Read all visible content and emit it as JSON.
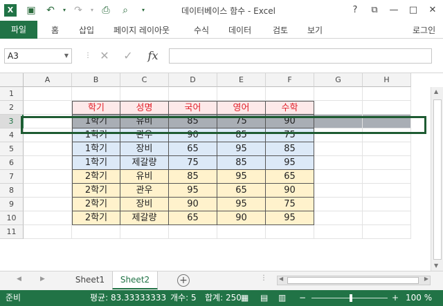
{
  "window": {
    "title": "데이터베이스 함수 - Excel",
    "help": "?",
    "restore": "⧉",
    "minimize": "—",
    "maximize": "□",
    "close": "✕"
  },
  "ribbon": {
    "file": "파일",
    "tabs": [
      "홈",
      "삽입",
      "페이지 레이아웃",
      "수식",
      "데이터",
      "검토",
      "보기"
    ],
    "signin": "로그인"
  },
  "formula_bar": {
    "name_box": "A3",
    "cancel": "✕",
    "enter": "✓",
    "fx": "fx",
    "value": ""
  },
  "columns": [
    "A",
    "B",
    "C",
    "D",
    "E",
    "F",
    "G",
    "H"
  ],
  "rows": [
    "1",
    "2",
    "3",
    "4",
    "5",
    "6",
    "7",
    "8",
    "9",
    "10",
    "11"
  ],
  "table": {
    "headers": [
      "학기",
      "성명",
      "국어",
      "영어",
      "수학"
    ],
    "data": [
      [
        "1학기",
        "유비",
        "85",
        "75",
        "90"
      ],
      [
        "1학기",
        "관우",
        "90",
        "85",
        "75"
      ],
      [
        "1학기",
        "장비",
        "65",
        "95",
        "85"
      ],
      [
        "1학기",
        "제갈량",
        "75",
        "85",
        "95"
      ],
      [
        "2학기",
        "유비",
        "85",
        "95",
        "65"
      ],
      [
        "2학기",
        "관우",
        "95",
        "65",
        "90"
      ],
      [
        "2학기",
        "장비",
        "90",
        "95",
        "75"
      ],
      [
        "2학기",
        "제갈량",
        "65",
        "90",
        "95"
      ]
    ]
  },
  "sheets": [
    "Sheet1",
    "Sheet2"
  ],
  "active_sheet": "Sheet2",
  "status": {
    "ready": "준비",
    "average": "평균: 83.33333333",
    "count": "개수: 5",
    "sum": "합계: 250",
    "zoom": "100 %"
  },
  "colors": {
    "accent": "#217346",
    "header_text": "#e0202a",
    "first_term_fill": "#dce9f7",
    "second_term_fill": "#fff2cc"
  }
}
